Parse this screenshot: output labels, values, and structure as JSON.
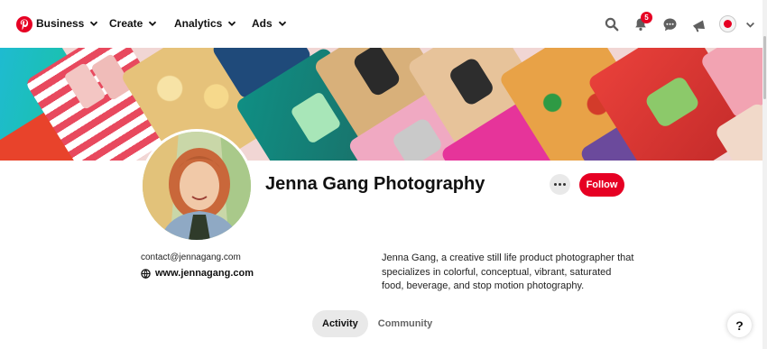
{
  "nav": {
    "items": [
      {
        "label": "Business"
      },
      {
        "label": "Create"
      },
      {
        "label": "Analytics"
      },
      {
        "label": "Ads"
      }
    ],
    "notification_count": "5"
  },
  "profile": {
    "name": "Jenna Gang Photography",
    "follow_label": "Follow",
    "email": "contact@jennagang.com",
    "website": "www.jennagang.com",
    "bio": "Jenna Gang, a creative still life product photographer that specializes in colorful, conceptual, vibrant, saturated food, beverage, and stop motion photography."
  },
  "tabs": [
    {
      "label": "Activity",
      "active": true
    },
    {
      "label": "Community",
      "active": false
    }
  ],
  "help_label": "?",
  "colors": {
    "brand": "#e60023",
    "tab_active_bg": "#e9e9e9"
  }
}
